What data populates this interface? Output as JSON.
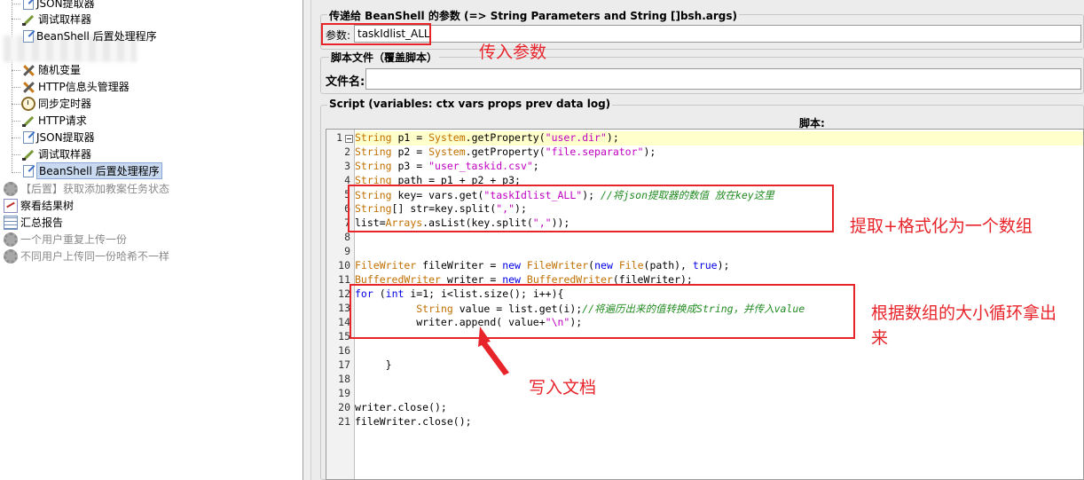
{
  "tree": {
    "items": [
      {
        "label": "JSON提取器",
        "icon": "json-extractor-icon"
      },
      {
        "label": "调试取样器",
        "icon": "debug-sampler-icon"
      },
      {
        "label": "BeanShell 后置处理程序",
        "icon": "beanshell-icon"
      },
      {
        "label": "随机变量",
        "icon": "random-variable-icon"
      },
      {
        "label": "HTTP信息头管理器",
        "icon": "header-manager-icon"
      },
      {
        "label": "同步定时器",
        "icon": "timer-icon"
      },
      {
        "label": "HTTP请求",
        "icon": "http-request-icon"
      },
      {
        "label": "JSON提取器",
        "icon": "json-extractor-icon"
      },
      {
        "label": "调试取样器",
        "icon": "debug-sampler-icon"
      },
      {
        "label": "BeanShell 后置处理程序",
        "icon": "beanshell-icon",
        "selected": true
      },
      {
        "label": "【后置】获取添加教案任务状态",
        "icon": "gear-icon",
        "disabled": true
      },
      {
        "label": "察看结果树",
        "icon": "results-tree-icon"
      },
      {
        "label": "汇总报告",
        "icon": "summary-report-icon"
      },
      {
        "label": "一个用户重复上传一份",
        "icon": "gear-icon",
        "disabled": true
      },
      {
        "label": "不同用户上传同一份哈希不一样",
        "icon": "gear-icon",
        "disabled": true
      }
    ]
  },
  "params": {
    "legend": "传递给 BeanShell 的参数 (=> String Parameters and String []bsh.args)",
    "label": "参数:",
    "value": "taskIdlist_ALL"
  },
  "file": {
    "legend": "脚本文件（覆盖脚本）",
    "label": "文件名:",
    "value": ""
  },
  "script": {
    "legend": "Script (variables: ctx vars props prev data log)",
    "header": "脚本:",
    "line_numbers": [
      "1",
      "2",
      "3",
      "4",
      "5",
      "6",
      "7",
      "8",
      "9",
      "10",
      "11",
      "12",
      "13",
      "14",
      "15",
      "16",
      "17",
      "18",
      "19",
      "20",
      "21"
    ]
  },
  "annotations": {
    "pass_param": "传入参数",
    "extract_format": "提取+格式化为一个数组",
    "loop": "根据数组的大小循环拿出",
    "loop_line2": "来",
    "write_doc": "写入文档"
  }
}
